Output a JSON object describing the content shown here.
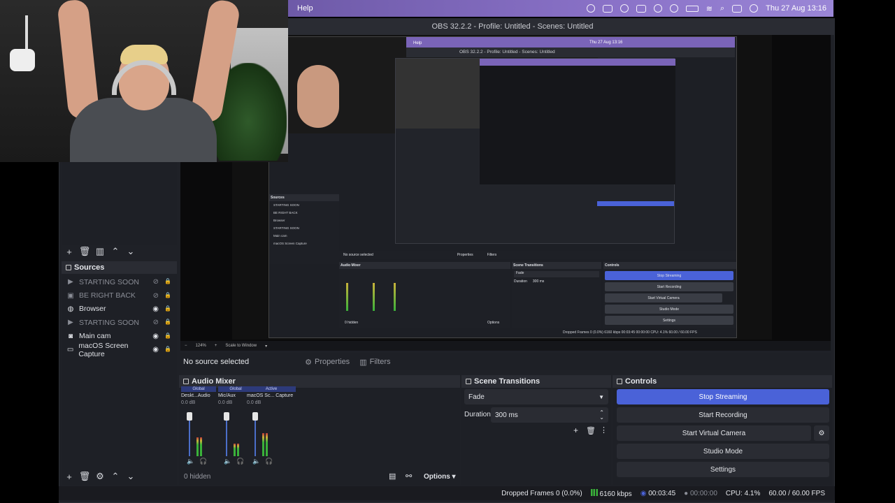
{
  "menubar": {
    "app_menu": "Help",
    "date_time": "Thu 27 Aug  13:16"
  },
  "window": {
    "title": "OBS 32.2.2 - Profile: Untitled - Scenes: Untitled"
  },
  "nested": {
    "menubar_help": "Help",
    "title": "OBS 32.2.2 - Profile: Untitled - Scenes: Untitled",
    "date_time": "Thu 27 Aug  13:16",
    "sources_title": "Sources",
    "sources": [
      "STARTING SOON",
      "BE RIGHT BACK",
      "Browser",
      "STARTING SOON",
      "Main cam",
      "macOS Screen Capture"
    ],
    "no_source": "No source selected",
    "properties": "Properties",
    "filters": "Filters",
    "mixer_title": "Audio Mixer",
    "transitions_title": "Scene Transitions",
    "controls_title": "Controls",
    "fade": "Fade",
    "duration_label": "Duration",
    "duration_value": "300 ms",
    "stop_streaming": "Stop Streaming",
    "start_recording": "Start Recording",
    "start_virtual_camera": "Start Virtual Camera",
    "studio_mode": "Studio Mode",
    "settings": "Settings",
    "hidden": "0 hidden",
    "options": "Options",
    "status": "Dropped Frames 0 (0.0%)   6160 kbps   00:03:45   00:00:00   CPU: 4.1%   60.00 / 60.00 FPS"
  },
  "preview_toolbar": {
    "zoom": "124%",
    "scale": "Scale to Window"
  },
  "sources_panel": {
    "title": "Sources",
    "items": [
      {
        "label": "STARTING SOON",
        "icon": "play-icon",
        "dim": true
      },
      {
        "label": "BE RIGHT BACK",
        "icon": "image-icon",
        "dim": true
      },
      {
        "label": "Browser",
        "icon": "globe-icon",
        "dim": false
      },
      {
        "label": "STARTING SOON",
        "icon": "play-icon",
        "dim": true
      },
      {
        "label": "Main cam",
        "icon": "camera-icon",
        "dim": false
      },
      {
        "label": "macOS Screen Capture",
        "icon": "monitor-icon",
        "dim": false
      }
    ]
  },
  "properties_bar": {
    "no_source": "No source selected",
    "properties": "Properties",
    "filters": "Filters"
  },
  "audio_mixer": {
    "title": "Audio Mixer",
    "channels": [
      {
        "badge": "Global",
        "name": "Deskt...Audio",
        "db": "0.0 dB",
        "level": 0.45
      },
      {
        "badge": "Global",
        "name": "Mic/Aux",
        "db": "0.0 dB",
        "level": 0.3
      },
      {
        "badge": "Active",
        "name": "macOS Sc... Capture",
        "db": "0.0 dB",
        "level": 0.55
      }
    ],
    "hidden": "0 hidden",
    "options": "Options"
  },
  "scene_transitions": {
    "title": "Scene Transitions",
    "transition": "Fade",
    "duration_label": "Duration",
    "duration_value": "300 ms"
  },
  "controls": {
    "title": "Controls",
    "stop_streaming": "Stop Streaming",
    "start_recording": "Start Recording",
    "start_virtual_camera": "Start Virtual Camera",
    "studio_mode": "Studio Mode",
    "settings": "Settings"
  },
  "status_bar": {
    "dropped_frames": "Dropped Frames 0 (0.0%)",
    "bitrate": "6160 kbps",
    "stream_time": "00:03:45",
    "record_time": "00:00:00",
    "cpu": "CPU: 4.1%",
    "fps": "60.00 / 60.00 FPS"
  },
  "colors": {
    "accent": "#4a62d8",
    "panel": "#1e2026",
    "menubar": "#8a72c8"
  }
}
